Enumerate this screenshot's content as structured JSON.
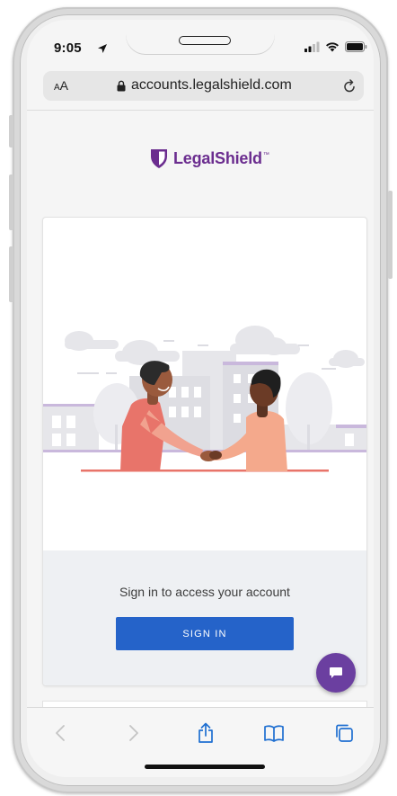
{
  "status_bar": {
    "time": "9:05"
  },
  "browser": {
    "text_size_label": "AA",
    "url": "accounts.legalshield.com"
  },
  "brand": {
    "name": "LegalShield"
  },
  "signin_card": {
    "prompt": "Sign in to access your account",
    "button_label": "SIGN IN"
  },
  "colors": {
    "brand_purple": "#6b2d8f",
    "button_blue": "#2563c9",
    "chat_purple": "#6b3fa0",
    "illustration_coral": "#e8746a",
    "illustration_lilac": "#c9b8dc"
  },
  "icons": {
    "location": "location-arrow-icon",
    "signal": "cellular-signal-icon",
    "wifi": "wifi-icon",
    "battery": "battery-icon",
    "lock": "lock-icon",
    "reload": "reload-icon",
    "back": "back-chevron-icon",
    "forward": "forward-chevron-icon",
    "share": "share-icon",
    "bookmarks": "bookmarks-icon",
    "tabs": "tabs-icon",
    "chat": "chat-bubble-icon"
  }
}
